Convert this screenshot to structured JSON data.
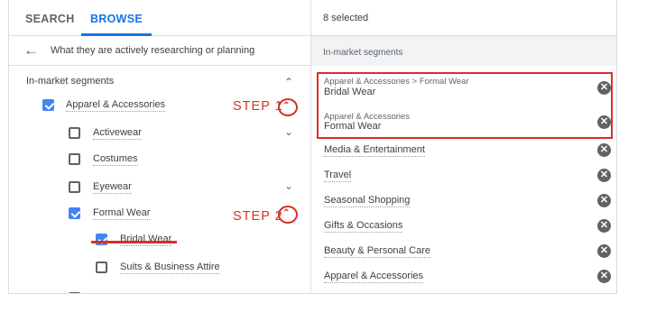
{
  "tabs": [
    {
      "label": "SEARCH"
    },
    {
      "label": "BROWSE"
    }
  ],
  "breadcrumb": {
    "text": "What they are actively researching or planning"
  },
  "tree": {
    "section_label": "In-market segments",
    "items": [
      {
        "label": "Apparel & Accessories",
        "checked": true
      },
      {
        "label": "Activewear",
        "checked": false
      },
      {
        "label": "Costumes",
        "checked": false
      },
      {
        "label": "Eyewear",
        "checked": false
      },
      {
        "label": "Formal Wear",
        "checked": true
      },
      {
        "label": "Bridal Wear",
        "checked": true
      },
      {
        "label": "Suits & Business Attire",
        "checked": false
      }
    ]
  },
  "annotations": {
    "step1": "STEP 1",
    "step2": "STEP 2",
    "accent_color": "#d93025"
  },
  "selected": {
    "count_label": "8 selected",
    "section_label": "In-market segments",
    "items": [
      {
        "path": "Apparel & Accessories > Formal Wear",
        "label": "Bridal Wear"
      },
      {
        "path": "Apparel & Accessories",
        "label": "Formal Wear"
      },
      {
        "path": "",
        "label": "Media & Entertainment"
      },
      {
        "path": "",
        "label": "Travel"
      },
      {
        "path": "",
        "label": "Seasonal Shopping"
      },
      {
        "path": "",
        "label": "Gifts & Occasions"
      },
      {
        "path": "",
        "label": "Beauty & Personal Care"
      },
      {
        "path": "",
        "label": "Apparel & Accessories"
      }
    ]
  },
  "colors": {
    "brand": "#1a73e8",
    "checkbox": "#4285f4",
    "remove_icon": "#5f6368",
    "panel_band": "#f1f3f4"
  }
}
